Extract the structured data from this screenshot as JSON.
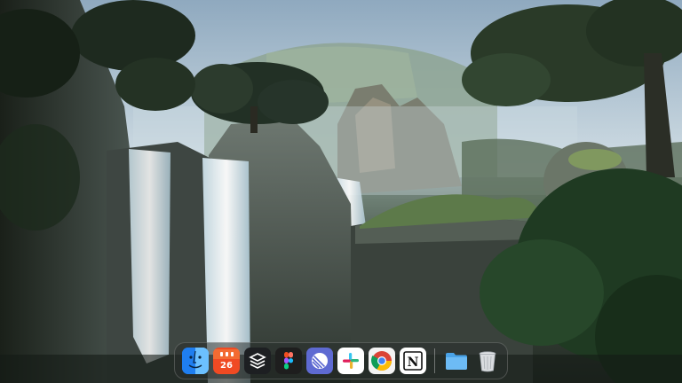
{
  "wallpaper": {
    "name": "jungle-waterfall-wallpaper"
  },
  "dock": {
    "items": [
      {
        "name": "finder",
        "icon": "finder-icon"
      },
      {
        "name": "fantastical",
        "icon": "calendar-icon",
        "badge_text": "26"
      },
      {
        "name": "layers",
        "icon": "layers-icon"
      },
      {
        "name": "figma",
        "icon": "figma-icon"
      },
      {
        "name": "linear",
        "icon": "linear-icon"
      },
      {
        "name": "slack",
        "icon": "slack-icon"
      },
      {
        "name": "chrome",
        "icon": "chrome-icon"
      },
      {
        "name": "notion",
        "icon": "notion-icon",
        "glyph": "N"
      },
      {
        "name": "downloads-folder",
        "icon": "folder-icon"
      },
      {
        "name": "trash",
        "icon": "trash-icon"
      }
    ]
  },
  "colors": {
    "finder_blue": "#1f7ef0",
    "fantastical_red": "#f04a23",
    "linear_purple": "#5e6ad2",
    "folder_blue": "#4aa3e8"
  }
}
